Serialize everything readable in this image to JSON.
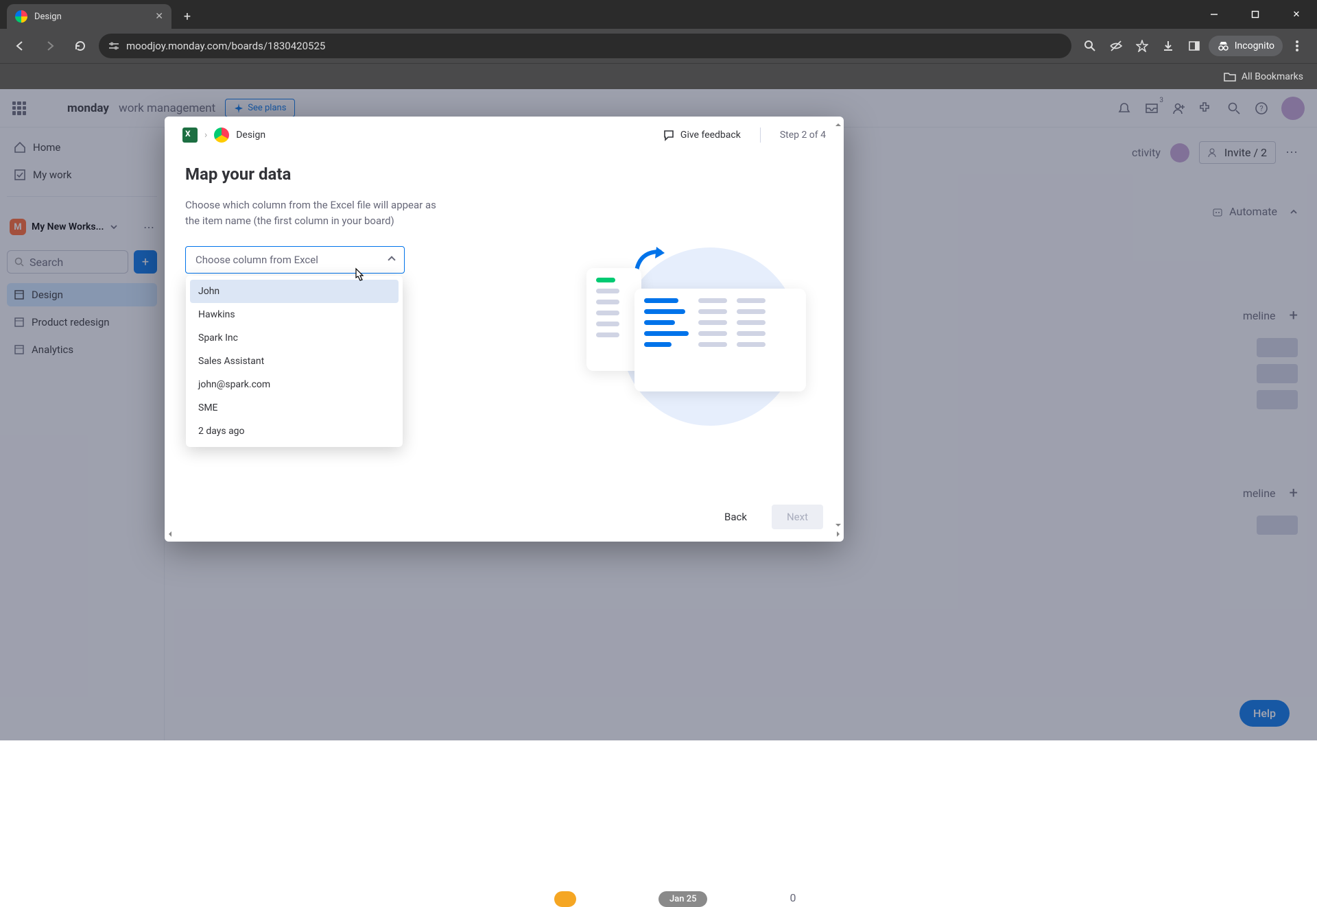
{
  "browser": {
    "tab_title": "Design",
    "url": "moodjoy.monday.com/boards/1830420525",
    "incognito_label": "Incognito",
    "bookmarks_label": "All Bookmarks"
  },
  "app": {
    "logo_bold": "monday",
    "logo_light": "work management",
    "see_plans": "See plans",
    "invite_label": "Invite / 2",
    "notif_badge": "3",
    "sidebar": {
      "home": "Home",
      "my_work": "My work",
      "workspace": "My New Works...",
      "search_placeholder": "Search",
      "boards": [
        "Design",
        "Product redesign",
        "Analytics"
      ]
    },
    "board": {
      "automate": "Automate",
      "activity": "ctivity",
      "timeline": "meline",
      "help": "Help",
      "date1": "",
      "date2": "Jan 25"
    }
  },
  "modal": {
    "breadcrumb_board": "Design",
    "feedback": "Give feedback",
    "step": "Step 2 of 4",
    "title": "Map your data",
    "description": "Choose which column from the Excel file will appear as the item name (the first column in your board)",
    "select_placeholder": "Choose column from Excel",
    "options": [
      "John",
      "Hawkins",
      "Spark Inc",
      "Sales Assistant",
      "john@spark.com",
      "SME",
      "2 days ago"
    ],
    "back": "Back",
    "next": "Next"
  }
}
